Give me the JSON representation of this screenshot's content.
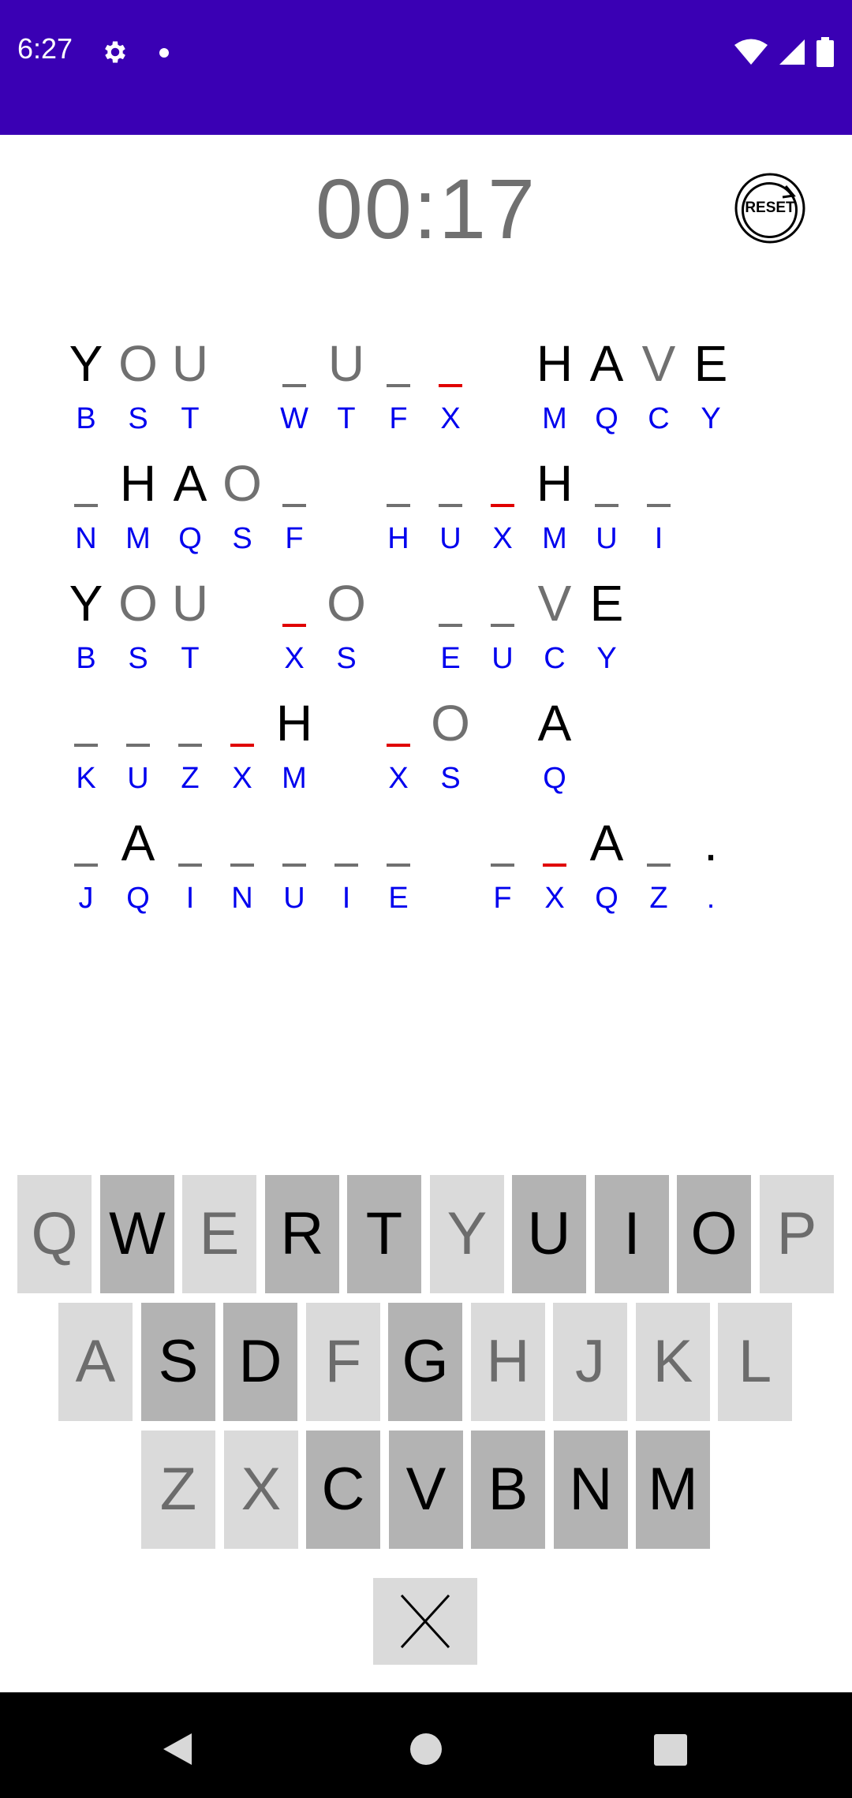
{
  "status_bar": {
    "time": "6:27",
    "icons": [
      "gear-icon",
      "notification-dot-icon",
      "wifi-icon",
      "signal-icon",
      "battery-icon"
    ],
    "bg_color": "#3a00b4"
  },
  "timer": {
    "value": "00:17"
  },
  "reset": {
    "label": "RESET"
  },
  "puzzle": {
    "rows": [
      [
        {
          "ch": "Y",
          "code": "B",
          "kind": "given"
        },
        {
          "ch": "O",
          "code": "S",
          "kind": "guess"
        },
        {
          "ch": "U",
          "code": "T",
          "kind": "guess"
        },
        null,
        {
          "ch": "",
          "code": "W",
          "kind": "blank"
        },
        {
          "ch": "U",
          "code": "T",
          "kind": "guess"
        },
        {
          "ch": "",
          "code": "F",
          "kind": "blank"
        },
        {
          "ch": "",
          "code": "X",
          "kind": "active"
        },
        null,
        {
          "ch": "H",
          "code": "M",
          "kind": "given"
        },
        {
          "ch": "A",
          "code": "Q",
          "kind": "given"
        },
        {
          "ch": "V",
          "code": "C",
          "kind": "guess"
        },
        {
          "ch": "E",
          "code": "Y",
          "kind": "given"
        }
      ],
      [
        {
          "ch": "",
          "code": "N",
          "kind": "blank"
        },
        {
          "ch": "H",
          "code": "M",
          "kind": "given"
        },
        {
          "ch": "A",
          "code": "Q",
          "kind": "given"
        },
        {
          "ch": "O",
          "code": "S",
          "kind": "guess"
        },
        {
          "ch": "",
          "code": "F",
          "kind": "blank"
        },
        null,
        {
          "ch": "",
          "code": "H",
          "kind": "blank"
        },
        {
          "ch": "",
          "code": "U",
          "kind": "blank"
        },
        {
          "ch": "",
          "code": "X",
          "kind": "active"
        },
        {
          "ch": "H",
          "code": "M",
          "kind": "given"
        },
        {
          "ch": "",
          "code": "U",
          "kind": "blank"
        },
        {
          "ch": "",
          "code": "I",
          "kind": "blank"
        }
      ],
      [
        {
          "ch": "Y",
          "code": "B",
          "kind": "given"
        },
        {
          "ch": "O",
          "code": "S",
          "kind": "guess"
        },
        {
          "ch": "U",
          "code": "T",
          "kind": "guess"
        },
        null,
        {
          "ch": "",
          "code": "X",
          "kind": "active"
        },
        {
          "ch": "O",
          "code": "S",
          "kind": "guess"
        },
        null,
        {
          "ch": "",
          "code": "E",
          "kind": "blank"
        },
        {
          "ch": "",
          "code": "U",
          "kind": "blank"
        },
        {
          "ch": "V",
          "code": "C",
          "kind": "guess"
        },
        {
          "ch": "E",
          "code": "Y",
          "kind": "given"
        }
      ],
      [
        {
          "ch": "",
          "code": "K",
          "kind": "blank"
        },
        {
          "ch": "",
          "code": "U",
          "kind": "blank"
        },
        {
          "ch": "",
          "code": "Z",
          "kind": "blank"
        },
        {
          "ch": "",
          "code": "X",
          "kind": "active"
        },
        {
          "ch": "H",
          "code": "M",
          "kind": "given"
        },
        null,
        {
          "ch": "",
          "code": "X",
          "kind": "active"
        },
        {
          "ch": "O",
          "code": "S",
          "kind": "guess"
        },
        null,
        {
          "ch": "A",
          "code": "Q",
          "kind": "given"
        }
      ],
      [
        {
          "ch": "",
          "code": "J",
          "kind": "blank"
        },
        {
          "ch": "A",
          "code": "Q",
          "kind": "given"
        },
        {
          "ch": "",
          "code": "I",
          "kind": "blank"
        },
        {
          "ch": "",
          "code": "N",
          "kind": "blank"
        },
        {
          "ch": "",
          "code": "U",
          "kind": "blank"
        },
        {
          "ch": "",
          "code": "I",
          "kind": "blank"
        },
        {
          "ch": "",
          "code": "E",
          "kind": "blank"
        },
        null,
        {
          "ch": "",
          "code": "F",
          "kind": "blank"
        },
        {
          "ch": "",
          "code": "X",
          "kind": "active"
        },
        {
          "ch": "A",
          "code": "Q",
          "kind": "given"
        },
        {
          "ch": "",
          "code": "Z",
          "kind": "blank"
        },
        {
          "ch": ".",
          "code": ".",
          "kind": "dot"
        }
      ]
    ]
  },
  "keyboard": {
    "rows": [
      [
        {
          "key": "Q",
          "used": true
        },
        {
          "key": "W",
          "used": false
        },
        {
          "key": "E",
          "used": true
        },
        {
          "key": "R",
          "used": false
        },
        {
          "key": "T",
          "used": false
        },
        {
          "key": "Y",
          "used": true
        },
        {
          "key": "U",
          "used": false
        },
        {
          "key": "I",
          "used": false
        },
        {
          "key": "O",
          "used": false
        },
        {
          "key": "P",
          "used": true
        }
      ],
      [
        {
          "key": "A",
          "used": true
        },
        {
          "key": "S",
          "used": false
        },
        {
          "key": "D",
          "used": false
        },
        {
          "key": "F",
          "used": true
        },
        {
          "key": "G",
          "used": false
        },
        {
          "key": "H",
          "used": true
        },
        {
          "key": "J",
          "used": true
        },
        {
          "key": "K",
          "used": true
        },
        {
          "key": "L",
          "used": true
        }
      ],
      [
        {
          "key": "Z",
          "used": true
        },
        {
          "key": "X",
          "used": true
        },
        {
          "key": "C",
          "used": false
        },
        {
          "key": "V",
          "used": false
        },
        {
          "key": "B",
          "used": false
        },
        {
          "key": "N",
          "used": false
        },
        {
          "key": "M",
          "used": false
        }
      ]
    ],
    "delete_icon": "close-icon"
  },
  "nav_bar": {
    "icons": [
      "back-icon",
      "home-icon",
      "recents-icon"
    ]
  }
}
